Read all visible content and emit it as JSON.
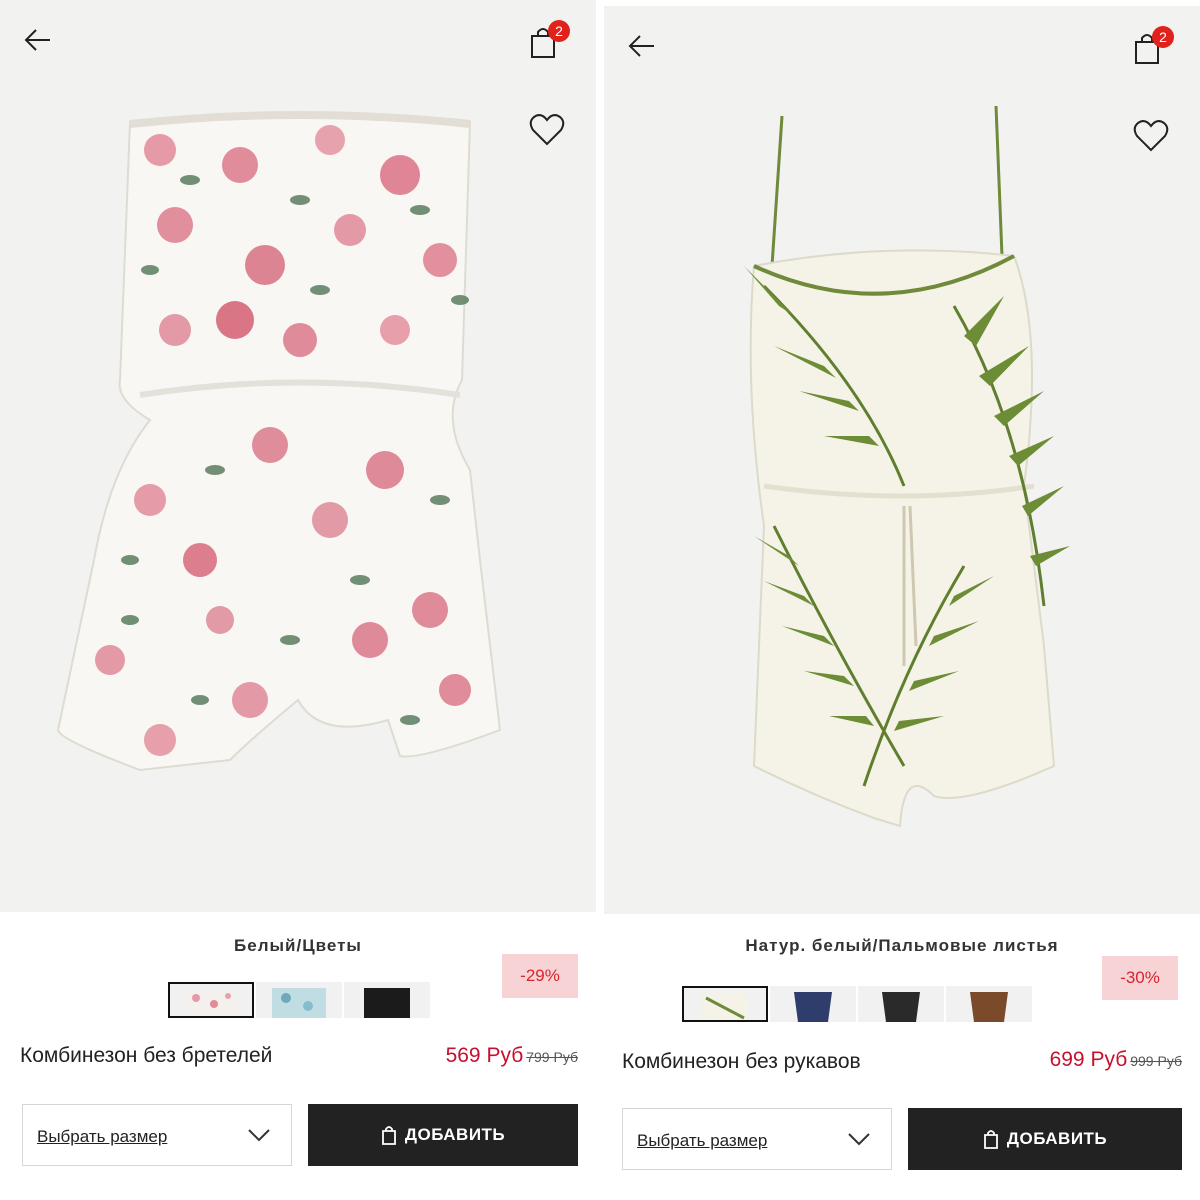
{
  "panels": [
    {
      "cart_count": "2",
      "color_name": "Белый/Цветы",
      "discount": "-29%",
      "product_name": "Комбинезон без бретелей",
      "price_new": "569 Руб",
      "price_old": "799 Руб",
      "size_label": "Выбрать размер",
      "add_label": "ДОБАВИТЬ",
      "swatch_colors": [
        "#f4f0ee",
        "#a6cbd4",
        "#1b1b1b"
      ]
    },
    {
      "cart_count": "2",
      "color_name": "Натур. белый/Пальмовые листья",
      "discount": "-30%",
      "product_name": "Комбинезон без рукавов",
      "price_new": "699 Руб",
      "price_old": "999 Руб",
      "size_label": "Выбрать размер",
      "add_label": "ДОБАВИТЬ",
      "swatch_colors": [
        "#6f8a3a",
        "#2e3d6b",
        "#2a2a2a",
        "#7a4a2a"
      ]
    }
  ],
  "colors": {
    "accent_red": "#c8102e",
    "badge_bg": "#f7d3d5",
    "button_dark": "#222222"
  }
}
